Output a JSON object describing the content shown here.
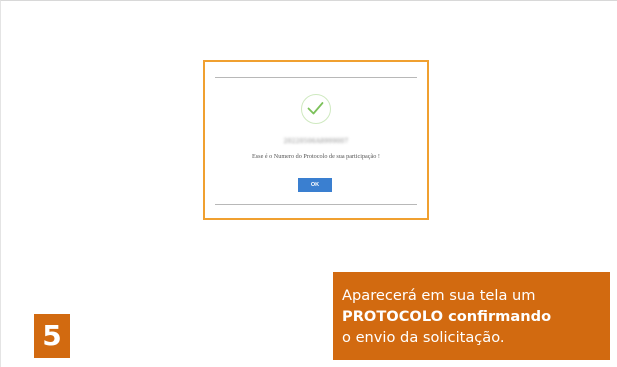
{
  "dialog": {
    "protocol_number": "20220506A8999007",
    "message": "Esse é o Numero do Protocolo de sua participação !",
    "ok_label": "OK",
    "icon": "check-icon"
  },
  "callout": {
    "line1": "Aparecerá em sua tela um",
    "line2_bold": "PROTOCOLO",
    "line2_rest": " confirmando",
    "line3": "o envio da solicitação."
  },
  "step": {
    "number": "5"
  },
  "colors": {
    "accent_orange": "#d26a10",
    "highlight_border": "#f0a030",
    "ok_button": "#3a7fd0",
    "check_green": "#7cc15a"
  }
}
